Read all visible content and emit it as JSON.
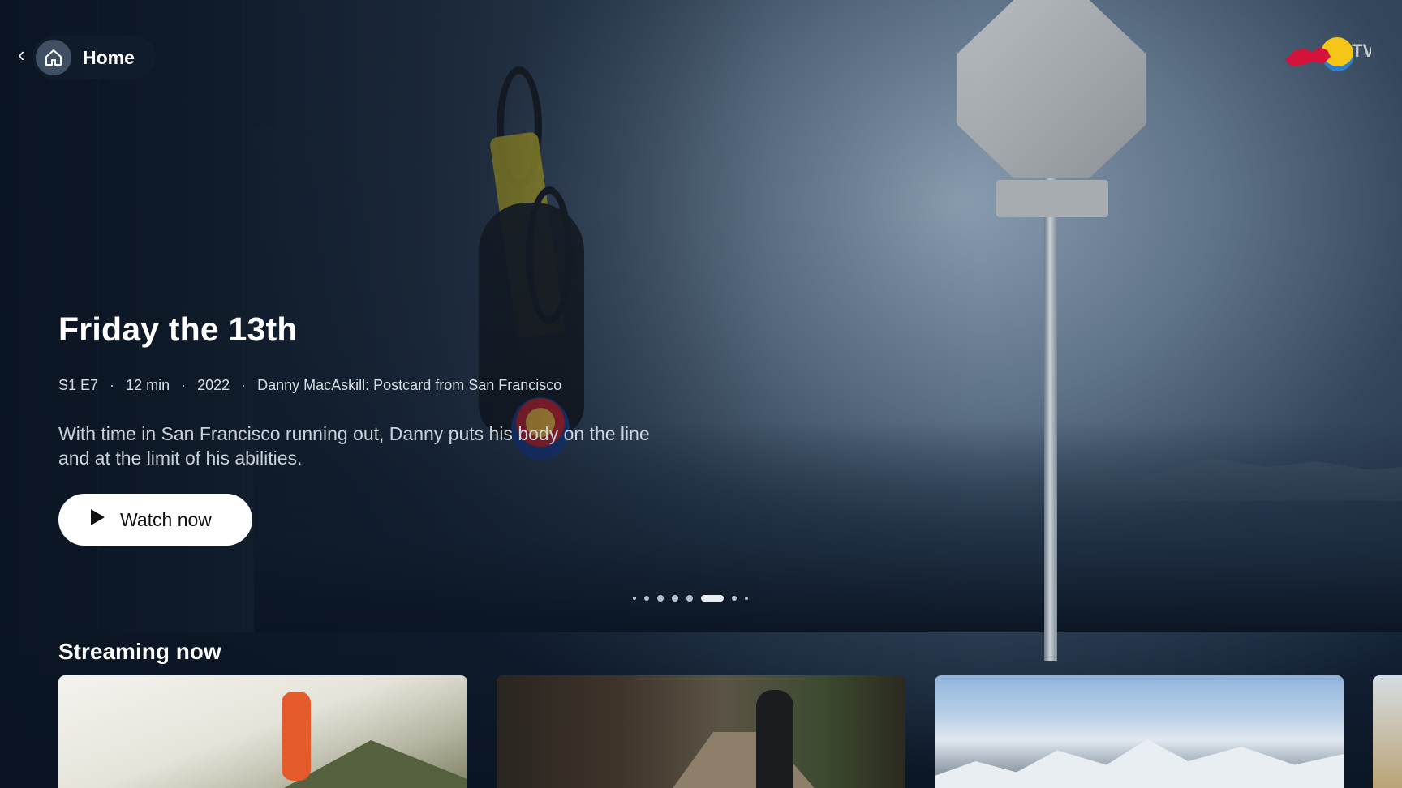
{
  "nav": {
    "back_icon": "chevron-left-icon",
    "home_icon": "home-icon",
    "home_label": "Home"
  },
  "brand": {
    "logo_text": "TV",
    "logo_name": "red-bull-tv-logo"
  },
  "hero": {
    "title": "Friday the 13th",
    "meta": {
      "episode": "S1 E7",
      "duration": "12 min",
      "year": "2022",
      "series": "Danny MacAskill: Postcard from San Francisco"
    },
    "description": "With time in San Francisco running out, Danny puts his body on the line and at the limit of his abilities.",
    "watch_label": "Watch now",
    "carousel": {
      "total_dots": 9,
      "active_index": 5
    }
  },
  "streaming_now": {
    "title": "Streaming now",
    "cards": [
      {
        "name": "trail-runner-card"
      },
      {
        "name": "downhill-mtb-card"
      },
      {
        "name": "mountain-aerial-card"
      },
      {
        "name": "desert-card-partial"
      }
    ]
  },
  "colors": {
    "background": "#0b1624",
    "button_bg": "#ffffff",
    "text_primary": "#ffffff",
    "text_secondary": "#c9d1da"
  }
}
